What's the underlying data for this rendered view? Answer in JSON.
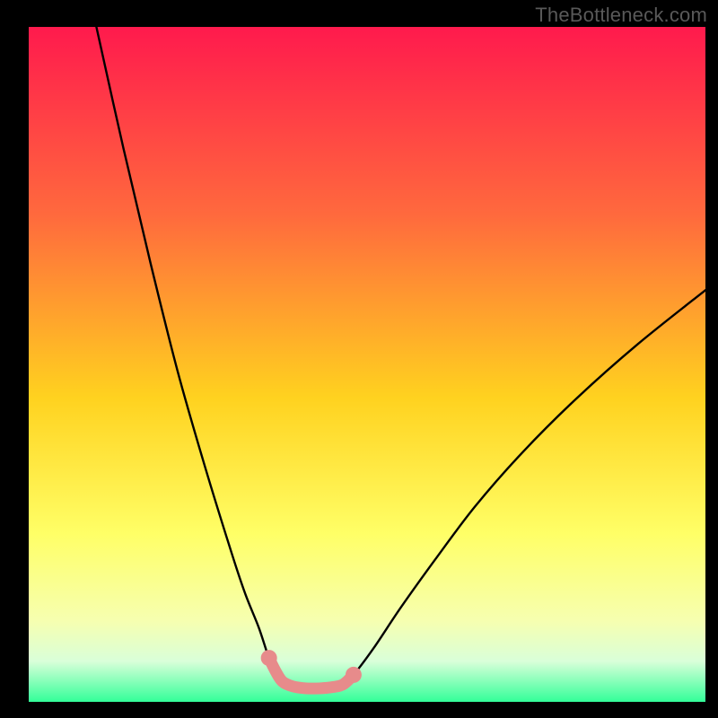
{
  "watermark": "TheBottleneck.com",
  "colors": {
    "black": "#000000",
    "curve": "#000000",
    "accent": "#e78b8b",
    "grad_top": "#ff1a4d",
    "grad_mid1": "#ff6a3d",
    "grad_mid2": "#ffd21f",
    "grad_mid3": "#ffff66",
    "grad_low1": "#f6ffb0",
    "grad_low2": "#d9ffd9",
    "grad_bottom": "#33ff99"
  },
  "chart_data": {
    "type": "line",
    "title": "",
    "xlabel": "",
    "ylabel": "",
    "xlim": [
      0,
      100
    ],
    "ylim": [
      0,
      100
    ],
    "series": [
      {
        "name": "left-arm",
        "x": [
          10,
          14,
          18,
          22,
          26,
          30,
          32,
          34,
          35.5,
          36.5,
          37.5
        ],
        "values": [
          100,
          82,
          65,
          49,
          35,
          22,
          16,
          11,
          6.5,
          4.5,
          3
        ]
      },
      {
        "name": "floor",
        "x": [
          37.5,
          39,
          41,
          43,
          45,
          46.5
        ],
        "values": [
          3,
          2.3,
          2,
          2,
          2.2,
          2.6
        ]
      },
      {
        "name": "right-arm",
        "x": [
          46.5,
          48,
          51,
          55,
          60,
          66,
          73,
          81,
          90,
          100
        ],
        "values": [
          2.6,
          4,
          8,
          14,
          21,
          29,
          37,
          45,
          53,
          61
        ]
      }
    ],
    "accent_points": {
      "name": "highlighted-segment",
      "x": [
        35.5,
        36.5,
        37.5,
        39,
        41,
        43,
        45,
        46.5,
        48
      ],
      "values": [
        6.5,
        4.5,
        3,
        2.3,
        2,
        2,
        2.2,
        2.6,
        4
      ]
    },
    "accent_endpoints": {
      "x": [
        35.5,
        48
      ],
      "values": [
        6.5,
        4
      ]
    }
  }
}
